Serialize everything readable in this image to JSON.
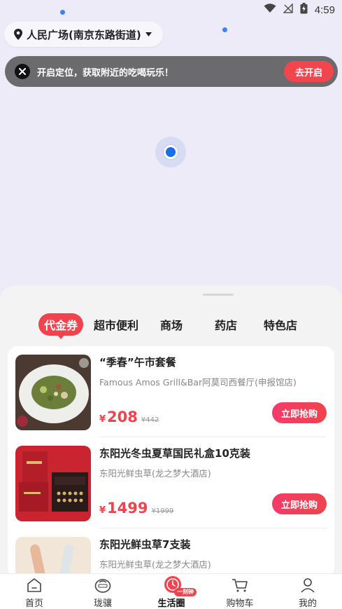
{
  "status_bar": {
    "time": "4:59"
  },
  "location": {
    "name": "人民广场(南京东路街道)"
  },
  "banner": {
    "text": "开启定位，获取附近的吃喝玩乐！",
    "button": "去开启"
  },
  "tabs": [
    {
      "label": "代金券",
      "active": true
    },
    {
      "label": "超市便利",
      "active": false
    },
    {
      "label": "商场",
      "active": false
    },
    {
      "label": "药店",
      "active": false
    },
    {
      "label": "特色店",
      "active": false
    }
  ],
  "items": [
    {
      "title": "“季春”午市套餐",
      "shop": "Famous Amos Grill&Bar阿莫司西餐厅(申报馆店)",
      "currency": "¥",
      "price": "208",
      "original_price": "¥442",
      "button": "立即抢购"
    },
    {
      "title": "东阳光冬虫夏草国民礼盒10克装",
      "shop": "东阳光鲜虫草(龙之梦大酒店)",
      "currency": "¥",
      "price": "1499",
      "original_price": "¥1999",
      "button": "立即抢购"
    },
    {
      "title": "东阳光鲜虫草7支装",
      "shop": "东阳光鲜虫草(龙之梦大酒店)",
      "currency": "¥",
      "price": "",
      "original_price": "",
      "button": ""
    }
  ],
  "bottom_nav": [
    {
      "label": "首页",
      "icon": "home-icon",
      "active": false
    },
    {
      "label": "珑骧",
      "icon": "bag-icon",
      "active": false
    },
    {
      "label": "生活圈",
      "icon": "clock-icon",
      "active": true,
      "badge": "一刻钟"
    },
    {
      "label": "购物车",
      "icon": "cart-icon",
      "active": false
    },
    {
      "label": "我的",
      "icon": "user-icon",
      "active": false
    }
  ],
  "colors": {
    "accent": "#f0434d",
    "map_bg": "#ecebf7",
    "location_dot": "#1a6cf0"
  }
}
